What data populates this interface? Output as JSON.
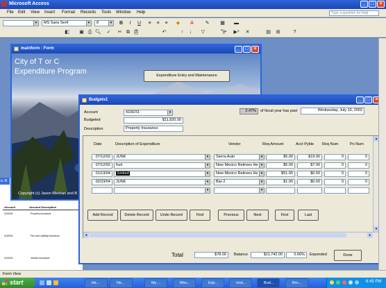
{
  "app": {
    "title": "Microsoft Access",
    "menus": [
      "File",
      "Edit",
      "View",
      "Insert",
      "Format",
      "Records",
      "Tools",
      "Window",
      "Help"
    ],
    "help_placeholder": "Type a question for help",
    "font_name": "MS Sans Serif",
    "font_size": "8"
  },
  "mainform": {
    "title": "mainform : Form",
    "heading_line1": "City of T or C",
    "heading_line2": "Expenditure Program",
    "button_label": "Expenditure Entry and Maintenance",
    "copyright": "Copyright (c) Jason Meehan and B"
  },
  "left_partial_tab": "ic R",
  "report_preview": {
    "col1": "Account",
    "col2": "Account Description",
    "rows": [
      {
        "acct": "4100/31",
        "desc": "Property Insurance"
      },
      {
        "acct": "4100/31",
        "desc": "Fire and Liability Insurance"
      },
      {
        "acct": "4100/31",
        "desc": "Vehicle Insurance"
      }
    ]
  },
  "budgets": {
    "title": "Budgets1",
    "account_label": "Account",
    "account_value": "4100/31",
    "budgeted_label": "Budgeted",
    "budgeted_value": "$11,820.00",
    "description_label": "Description",
    "description_value": "Property Insurance",
    "fiscal_percent": "2.47%",
    "fiscal_text": "of fiscal year has past",
    "date_value": "Wednesday, July 10, 2002",
    "columns": [
      "Date",
      "Description of Expenditure",
      "Vendor",
      "Req Amount",
      "Acct Pyble",
      "Req Num",
      "Po Num"
    ],
    "rows": [
      {
        "date": "07/12/02",
        "desc": "JUNK",
        "vendor": "Sierra Auto",
        "req": "$5.00",
        "pyble": "$19.00",
        "reqnum": "0",
        "ponum": "0"
      },
      {
        "date": "07/12/02",
        "desc": "fruit",
        "vendor": "New Mexico Retirees He",
        "req": "$5.00",
        "pyble": "$7.00",
        "reqnum": "0",
        "ponum": "0"
      },
      {
        "date": "01/13/04",
        "desc": "Junked",
        "vendor": "New Mexico Retirees He",
        "req": "$51.00",
        "pyble": "$0.00",
        "reqnum": "0",
        "ponum": "0"
      },
      {
        "date": "02/23/04",
        "desc": "JUNK",
        "vendor": "Bar-2",
        "req": "$1.00",
        "pyble": "$0.00",
        "reqnum": "0",
        "ponum": "0"
      }
    ],
    "buttons": [
      "Add Record",
      "Delete Record",
      "Undo Record",
      "Find",
      "Previous",
      "Next",
      "First",
      "Last"
    ],
    "total_label": "Total",
    "total_value": "$78.00",
    "balance_label": "Balance",
    "balance_value": "$11,742.00",
    "expended_pct": "0.66%",
    "expended_label": "Expended",
    "done_label": "Done"
  },
  "status_bar": "Form View",
  "taskbar": {
    "start": "start",
    "items": [
      "trb...",
      "Ne...",
      "My ...",
      "Micr...",
      "Exp...",
      "mck...",
      "Bud...",
      "Bro..."
    ],
    "clock": "6:45 PM"
  },
  "colors": {
    "xp_blue": "#2e64d8",
    "start_green": "#3c9a34",
    "face": "#ece9d8"
  }
}
